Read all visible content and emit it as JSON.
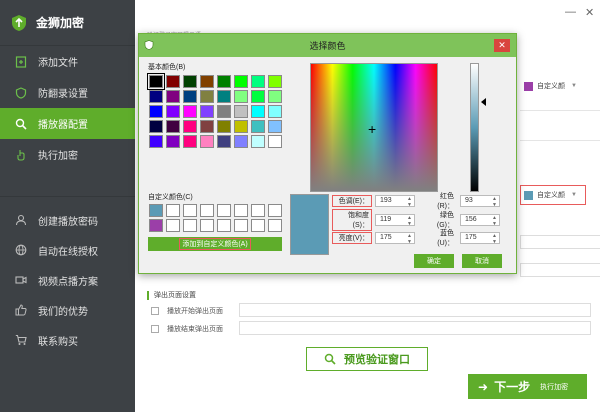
{
  "app": {
    "name": "金狮加密",
    "window_controls": {
      "minimize": "—",
      "close": "✕"
    }
  },
  "sidebar": {
    "items": [
      {
        "label": "添加文件",
        "icon": "add-file-icon",
        "active": false
      },
      {
        "label": "防翻录设置",
        "icon": "shield-icon",
        "active": false
      },
      {
        "label": "播放器配置",
        "icon": "search-icon",
        "active": true
      },
      {
        "label": "执行加密",
        "icon": "hand-icon",
        "active": false
      },
      {
        "label": "创建播放密码",
        "icon": "user-icon",
        "active": false
      },
      {
        "label": "自动在线授权",
        "icon": "globe-icon",
        "active": false
      },
      {
        "label": "视频点播方案",
        "icon": "video-icon",
        "active": false
      },
      {
        "label": "我们的优势",
        "icon": "thumbs-up-icon",
        "active": false
      },
      {
        "label": "联系购买",
        "icon": "cart-icon",
        "active": false
      }
    ]
  },
  "main": {
    "truncated_label": "验证登录窗口提示语",
    "color_picker_top": {
      "label": "自定义颜",
      "swatch": "#9b3fa8"
    },
    "color_picker_mid": {
      "label": "自定义颜",
      "swatch": "#5b9bb5"
    },
    "popup_section": {
      "title": "弹出页面设置",
      "options": [
        {
          "label": "播放开始弹出页面"
        },
        {
          "label": "播放结束弹出页面"
        }
      ]
    },
    "preview_button": "预览验证窗口",
    "next_button": {
      "label": "下一步",
      "sub": "执行加密"
    }
  },
  "dialog": {
    "title": "选择颜色",
    "close": "✕",
    "basic_colors_label": "基本颜色(B)",
    "basic_colors": [
      "#000000",
      "#800000",
      "#004000",
      "#804000",
      "#008000",
      "#00ff00",
      "#00ff80",
      "#80ff00",
      "#000080",
      "#800080",
      "#004080",
      "#808040",
      "#008080",
      "#80ff80",
      "#00ff40",
      "#80ff80",
      "#0000ff",
      "#8000ff",
      "#ff00ff",
      "#8040ff",
      "#808080",
      "#c0c0c0",
      "#00ffff",
      "#80ffff",
      "#000040",
      "#400040",
      "#ff0080",
      "#804040",
      "#808000",
      "#c0c000",
      "#40c0c0",
      "#80c0ff",
      "#4000ff",
      "#8000c0",
      "#ff0080",
      "#ff80c0",
      "#404080",
      "#8080ff",
      "#c0ffff",
      "#ffffff"
    ],
    "selected_basic_index": 0,
    "custom_colors_label": "自定义颜色(C)",
    "custom_colors": [
      "#5b9bb5",
      "#ffffff",
      "#ffffff",
      "#ffffff",
      "#ffffff",
      "#ffffff",
      "#ffffff",
      "#ffffff",
      "#9b3fa8",
      "#ffffff",
      "#ffffff",
      "#ffffff",
      "#ffffff",
      "#ffffff",
      "#ffffff",
      "#ffffff"
    ],
    "add_custom_button": "添加到自定义颜色(A)",
    "hue_label": "色调(E)：",
    "hue_value": "193",
    "sat_label": "饱和度(S)：",
    "sat_value": "119",
    "lum_label": "亮度(V)：",
    "lum_value": "175",
    "red_label": "红色(R)：",
    "red_value": "93",
    "green_label": "绿色(G)：",
    "green_value": "156",
    "blue_label": "蓝色(U)：",
    "blue_value": "175",
    "preview_color": "#5b9bb5",
    "ok_button": "确定",
    "cancel_button": "取消"
  },
  "colors": {
    "accent": "#5fad2b",
    "sidebar_bg": "#3d4145",
    "dialog_titlebar": "#7fc35a",
    "highlight_border": "#e85b5b"
  }
}
